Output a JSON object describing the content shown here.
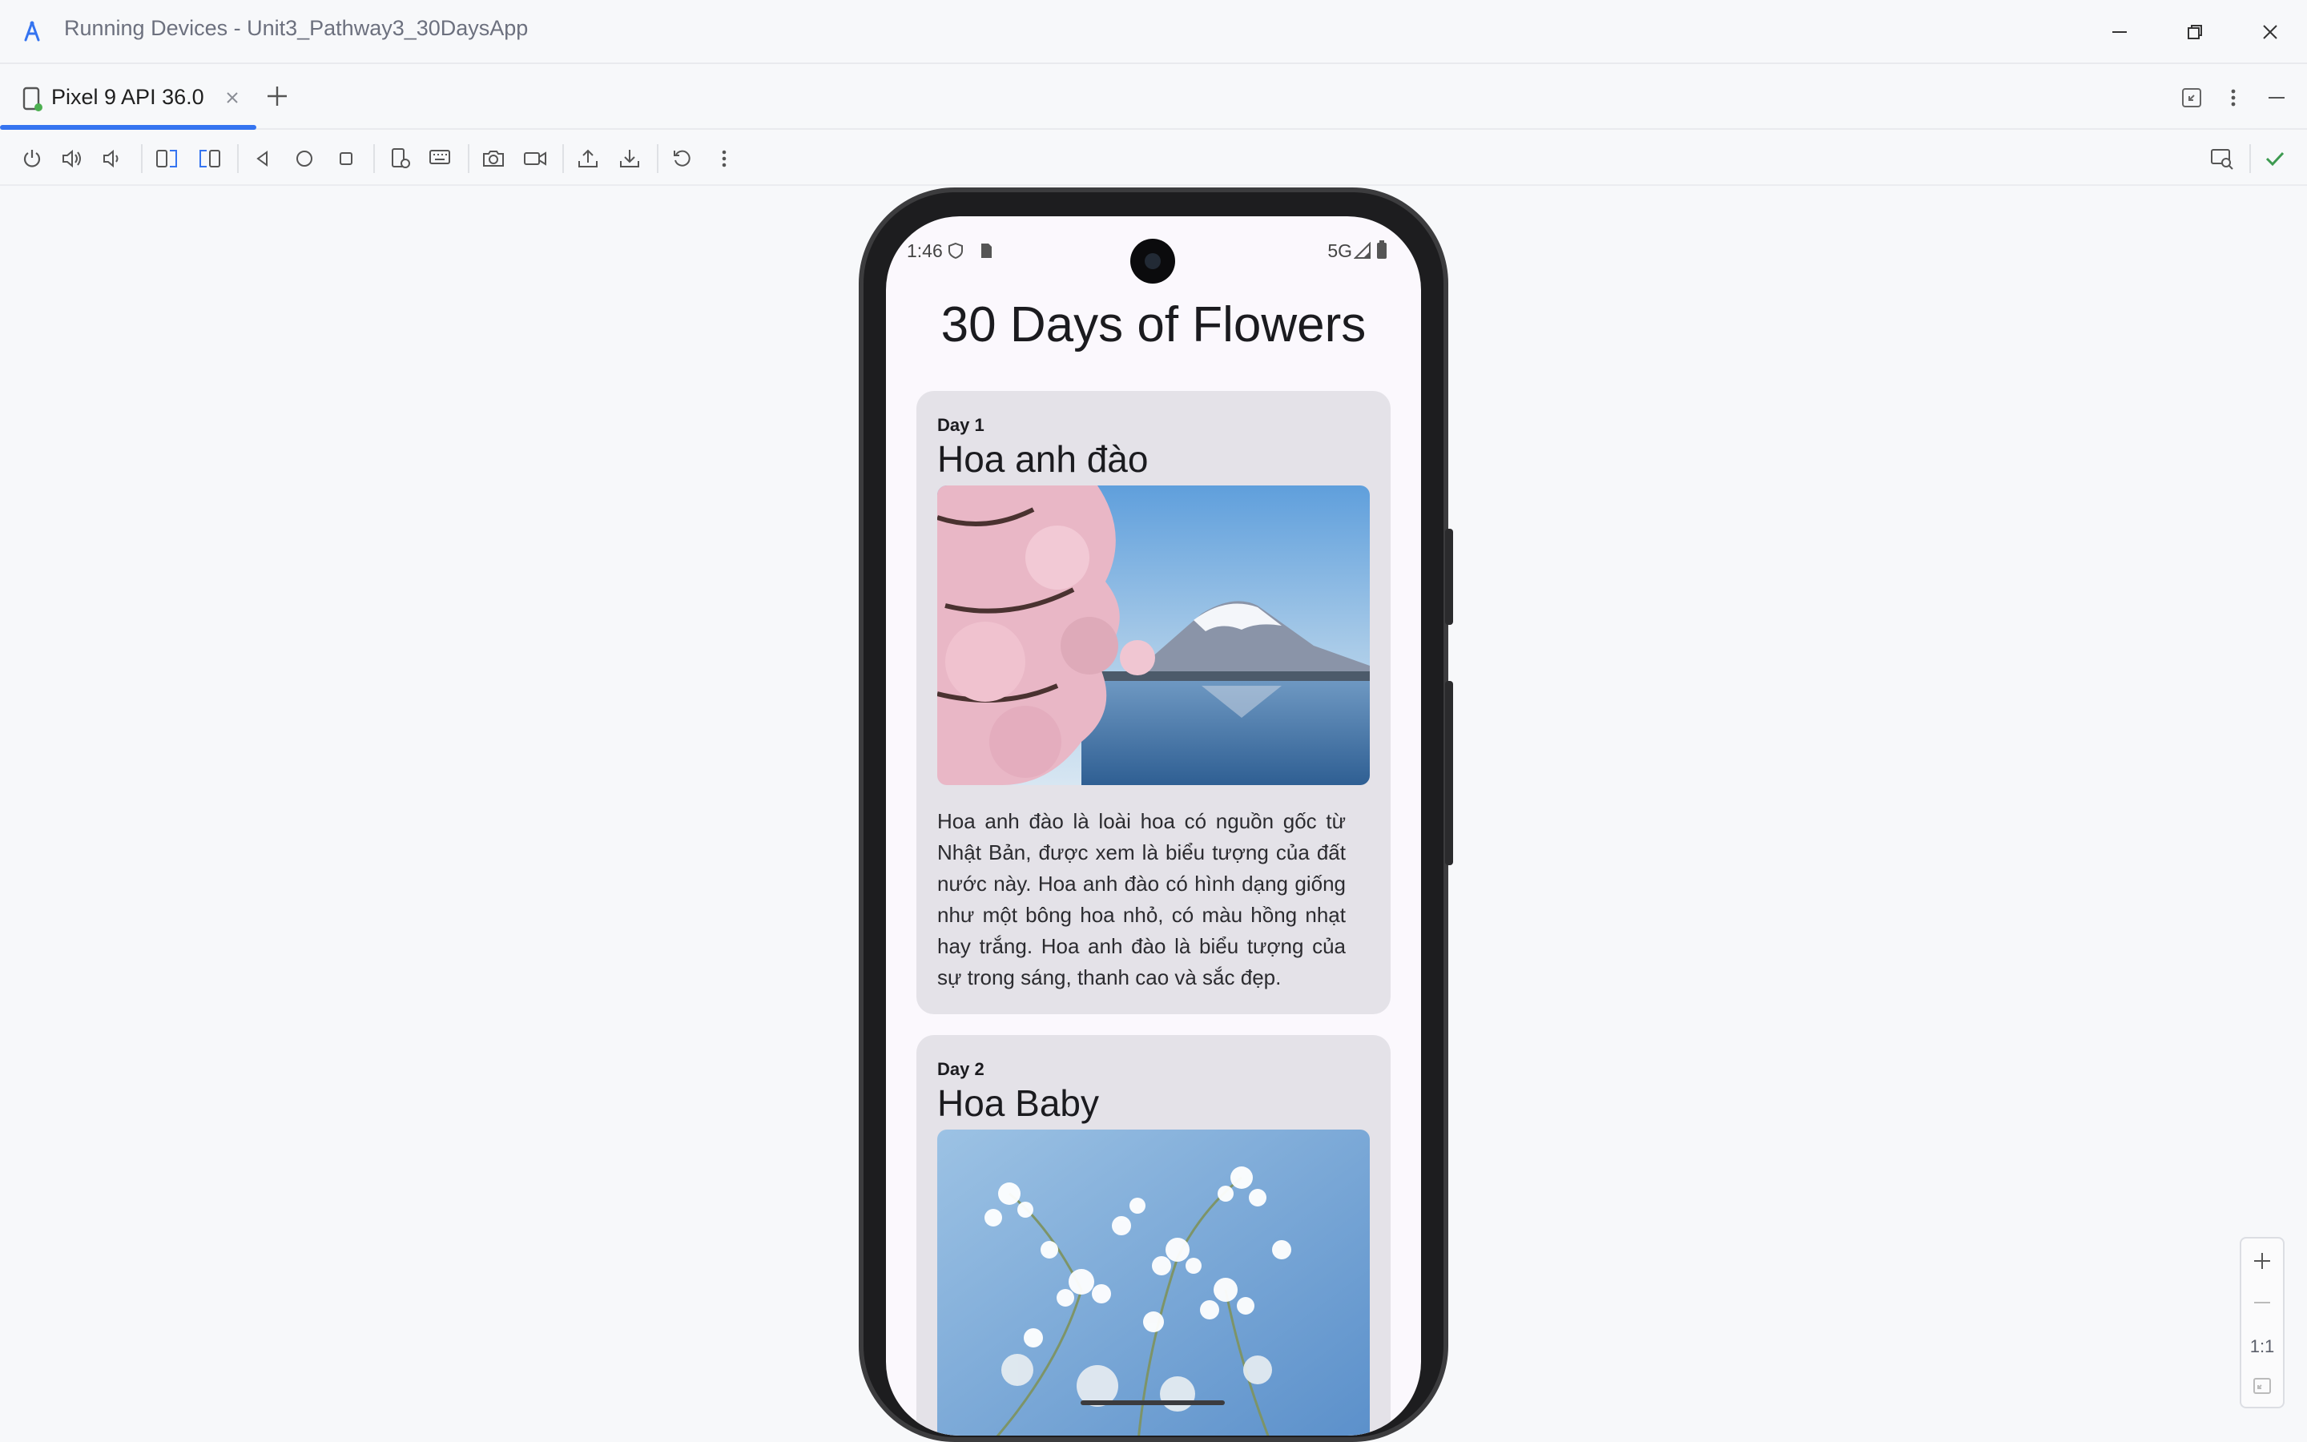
{
  "window": {
    "title": "Running Devices - Unit3_Pathway3_30DaysApp",
    "controls": {
      "minimize": "minimize-icon",
      "restore": "restore-icon",
      "close": "close-icon"
    }
  },
  "tabs": [
    {
      "label": "Pixel 9 API 36.0",
      "active": true
    }
  ],
  "toolbar": {
    "buttons": [
      "power-icon",
      "volume-up-icon",
      "volume-down-icon",
      "rotate-left-icon",
      "rotate-right-icon",
      "back-icon",
      "home-icon",
      "overview-icon",
      "device-settings-icon",
      "keyboard-icon",
      "screenshot-icon",
      "screen-record-icon",
      "upload-icon",
      "download-icon",
      "reset-icon",
      "more-options-icon"
    ],
    "right": [
      "device-inspect-icon",
      "checkmark-icon"
    ]
  },
  "phone": {
    "status_bar": {
      "time": "1:46",
      "network": "5G"
    },
    "app_title": "30 Days of Flowers",
    "cards": [
      {
        "day": "Day 1",
        "name": "Hoa anh đào",
        "description": "Hoa anh đào là loài hoa có nguồn gốc từ Nhật Bản, được xem là biểu tượng của đất nước này. Hoa anh đào có hình dạng giống như một bông hoa nhỏ, có màu hồng nhạt hay trắng. Hoa anh đào là biểu tượng của sự trong sáng, thanh cao và sắc đẹp."
      },
      {
        "day": "Day 2",
        "name": "Hoa Baby",
        "description": ""
      }
    ]
  },
  "zoom": {
    "actual_size_label": "1:1"
  },
  "colors": {
    "accent": "#3574f0",
    "success": "#3d9a50",
    "card": "#e4e2e8"
  }
}
